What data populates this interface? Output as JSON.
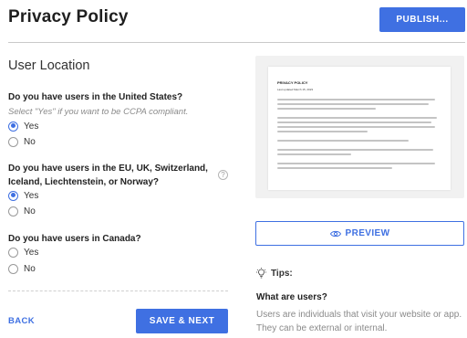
{
  "header": {
    "title": "Privacy Policy",
    "publish_label": "PUBLISH..."
  },
  "form": {
    "section_title": "User Location",
    "questions": [
      {
        "text": "Do you have users in the United States?",
        "hint": "Select \"Yes\" if you want to be CCPA compliant.",
        "options": [
          "Yes",
          "No"
        ],
        "selected": "Yes"
      },
      {
        "text_line1": "Do you have users in the EU, UK, Switzerland,",
        "text_line2": "Iceland, Liechtenstein, or Norway?",
        "help_icon": "?",
        "options": [
          "Yes",
          "No"
        ],
        "selected": "Yes"
      },
      {
        "text": "Do you have users in Canada?",
        "options": [
          "Yes",
          "No"
        ],
        "selected": null
      }
    ],
    "back_label": "BACK",
    "save_label": "SAVE & NEXT"
  },
  "preview": {
    "doc_title": "PRIVACY POLICY",
    "doc_date": "Last updated March 15, 2023",
    "button_label": "PREVIEW",
    "icon": "eye-icon"
  },
  "tips": {
    "label": "Tips:",
    "icon": "lightbulb-icon",
    "question": "What are users?",
    "answer": "Users are individuals that visit your website or app. They can be external or internal."
  },
  "colors": {
    "accent": "#3f70e2",
    "hint_text": "#8a8a8a",
    "divider": "#c9c9c9"
  }
}
